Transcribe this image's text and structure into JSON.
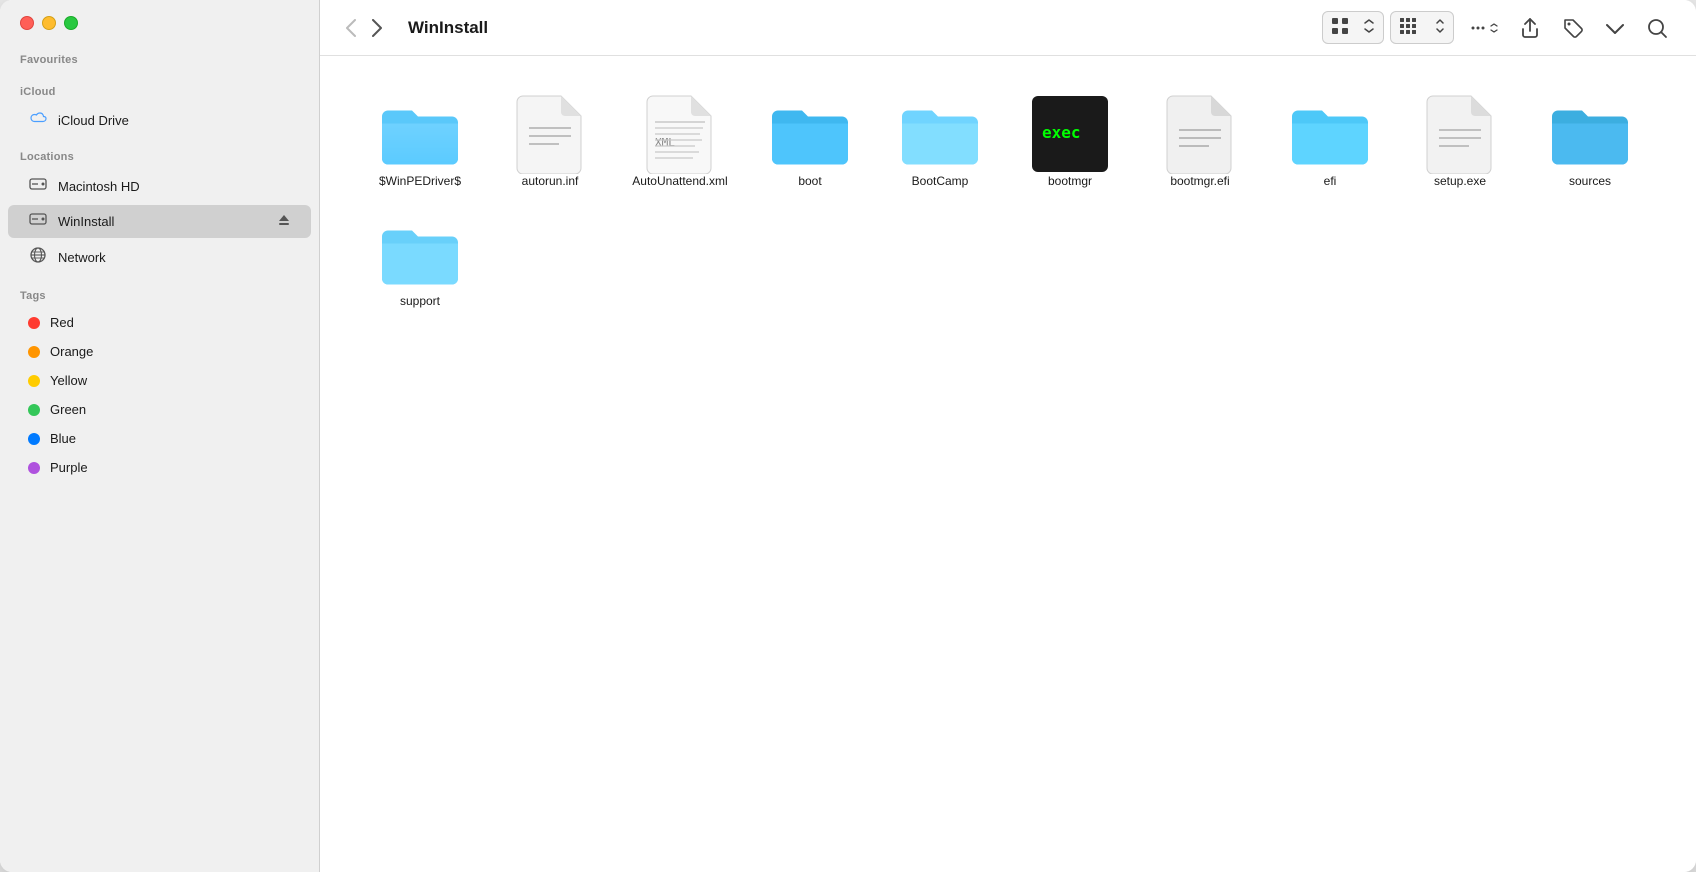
{
  "window": {
    "title": "WinInstall"
  },
  "sidebar": {
    "favourites_label": "Favourites",
    "icloud_label": "iCloud",
    "icloud_drive": "iCloud Drive",
    "locations_label": "Locations",
    "tags_label": "Tags",
    "locations": [
      {
        "id": "macintosh-hd",
        "label": "Macintosh HD",
        "icon": "disk"
      },
      {
        "id": "wininstall",
        "label": "WinInstall",
        "icon": "disk",
        "active": true,
        "eject": true
      },
      {
        "id": "network",
        "label": "Network",
        "icon": "globe"
      }
    ],
    "tags": [
      {
        "id": "red",
        "label": "Red",
        "color": "#ff3b30"
      },
      {
        "id": "orange",
        "label": "Orange",
        "color": "#ff9500"
      },
      {
        "id": "yellow",
        "label": "Yellow",
        "color": "#ffcc00"
      },
      {
        "id": "green",
        "label": "Green",
        "color": "#34c759"
      },
      {
        "id": "blue",
        "label": "Blue",
        "color": "#007aff"
      },
      {
        "id": "purple",
        "label": "Purple",
        "color": "#af52de"
      }
    ]
  },
  "toolbar": {
    "back_label": "‹",
    "forward_label": "›",
    "title": "WinInstall",
    "view_grid_label": "⊞",
    "view_list_label": "≡",
    "share_label": "↑",
    "tag_label": "🏷",
    "more_label": "…",
    "more2_label": "»",
    "search_label": "⌕"
  },
  "files": [
    {
      "id": "winpedriver",
      "name": "$WinPEDriver$",
      "type": "folder-blue"
    },
    {
      "id": "autorun-inf",
      "name": "autorun.inf",
      "type": "file-blank"
    },
    {
      "id": "autounattend-xml",
      "name": "AutoUnattend.xml",
      "type": "file-xml"
    },
    {
      "id": "boot",
      "name": "boot",
      "type": "folder-blue"
    },
    {
      "id": "bootcamp",
      "name": "BootCamp",
      "type": "folder-blue-light"
    },
    {
      "id": "bootmgr",
      "name": "bootmgr",
      "type": "file-exec"
    },
    {
      "id": "bootmgr-efi",
      "name": "bootmgr.efi",
      "type": "file-blank-dark"
    },
    {
      "id": "efi",
      "name": "efi",
      "type": "folder-blue"
    },
    {
      "id": "setup-exe",
      "name": "setup.exe",
      "type": "file-blank-dark"
    },
    {
      "id": "sources",
      "name": "sources",
      "type": "folder-blue-dark"
    },
    {
      "id": "support",
      "name": "support",
      "type": "folder-blue-light"
    }
  ]
}
